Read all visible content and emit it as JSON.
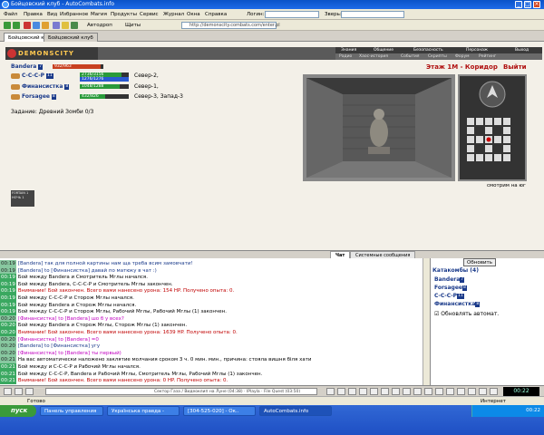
{
  "window": {
    "title": "Бойцовский клуб - AutoCombats.info"
  },
  "menu": {
    "items": [
      "Файл",
      "Правка",
      "Вид",
      "Избранное",
      "Магия",
      "Продукты",
      "Сервис",
      "Журнал",
      "Окна",
      "Справка"
    ],
    "login_label": "Логин:",
    "beast_label": "Зверь:"
  },
  "toolbar": {
    "autodrop": "Автодроп",
    "shields": "Щиты",
    "address": "http://demonscity.combats.com/enter.pl"
  },
  "tabs": [
    "Бойцовский клуб",
    "Бойцовский клуб"
  ],
  "site": {
    "logo": "DEMONSCITY",
    "nav_top": [
      "Знания",
      "Общение",
      "Безопасность",
      "Персонаж",
      "Выход"
    ],
    "nav_sub": [
      "Радио",
      "Хаос-история",
      "События",
      "Скрипты",
      "Форум",
      "Рейтинг"
    ]
  },
  "player": {
    "name": "Bandera",
    "level": "7",
    "hp_text": "932/963"
  },
  "team": [
    {
      "name": "С-С-С-Р",
      "level": "11",
      "hp": "2736/3156",
      "mana": "1276/1276",
      "location": "Север-2,"
    },
    {
      "name": "Финансистка",
      "level": "8",
      "hp": "1048/1288",
      "mana": "",
      "location": "Север-1,"
    },
    {
      "name": "Forsagee",
      "level": "8",
      "hp": "432/826",
      "mana": "",
      "location": "Север-3, Запад-3"
    }
  ],
  "task": "Задание: Древний Зомби 0/3",
  "smallbox": {
    "line1": "FORTAIN 1",
    "line2": "НОЧЬ 1"
  },
  "location": {
    "title": "Этаж 1М - Коридор",
    "exit": "Выйти",
    "facing": "смотрим на юг"
  },
  "chat_tabs": [
    "Чат",
    "Системные сообщения"
  ],
  "chat": [
    {
      "time": "00:19",
      "text": "[Bandera] так для полной картины нам ща треба всим замовчати!",
      "color": "#1a3a8a",
      "green": false
    },
    {
      "time": "00:19",
      "text": "[Bandera] to [Финансистка] давай по матюку в чат :)",
      "color": "#1a3a8a",
      "green": false
    },
    {
      "time": "00:19",
      "text": "Бой между Bandera и Смотритель Мглы начался.",
      "color": "#000",
      "green": true
    },
    {
      "time": "00:19",
      "text": "Бой между Bandera, С-С-С-Р и Смотритель Мглы закончен.",
      "color": "#000",
      "green": true
    },
    {
      "time": "00:19",
      "text": "Внимание! Бой закончен. Всего вами нанесено урона: 154 HP. Получено опыта: 0.",
      "color": "#c00000",
      "green": true
    },
    {
      "time": "00:19",
      "text": "Бой между С-С-С-Р и Сторож Мглы начался.",
      "color": "#000",
      "green": true
    },
    {
      "time": "00:19",
      "text": "Бой между Bandera и Сторож Мглы начался.",
      "color": "#000",
      "green": true
    },
    {
      "time": "00:19",
      "text": "Бой между С-С-С-Р и Сторож Мглы, Рабочий Мглы, Рабочий Мглы (1) закончен.",
      "color": "#000",
      "green": true
    },
    {
      "time": "00:20",
      "text": "[Финансистка] to [Bandera] шо б у всех?",
      "color": "#c000c0",
      "green": false
    },
    {
      "time": "00:20",
      "text": "Бой между Bandera и Сторож Мглы, Сторож Мглы (1) закончен.",
      "color": "#000",
      "green": true
    },
    {
      "time": "00:20",
      "text": "Внимание! Бой закончен. Всего вами нанесено урона: 1639 HP. Получено опыта: 0.",
      "color": "#c00000",
      "green": true
    },
    {
      "time": "00:20",
      "text": "[Финансистка] to [Bandera] =0",
      "color": "#c000c0",
      "green": false
    },
    {
      "time": "00:20",
      "text": "[Bandera] to [Финансистка] угу",
      "color": "#1a3a8a",
      "green": false
    },
    {
      "time": "00:20",
      "text": "[Финансистка] to [Bandera] ты первый)",
      "color": "#c000c0",
      "green": false
    },
    {
      "time": "00:21",
      "text": "На вас автоматически наложено заклятие молчания сроком 3 ч. 0 мин. мин., причина: стояла вишня біля хати",
      "color": "#000",
      "green": false
    },
    {
      "time": "00:21",
      "text": "Бой между и С-С-С-Р и Рабочий Мглы начался.",
      "color": "#000",
      "green": true
    },
    {
      "time": "00:21",
      "text": "Бой между С-С-С-Р, Bandera и Рабочий Мглы, Смотритель Мглы, Рабочий Мглы (1) закончен.",
      "color": "#000",
      "green": true
    },
    {
      "time": "00:21",
      "text": "Внимание! Бой закончен. Всего вами нанесено урона: 0 HP. Получено опыта: 0.",
      "color": "#c00000",
      "green": true
    }
  ],
  "side": {
    "refresh": "Обновить",
    "header": "Катакомбы (4)",
    "members": [
      {
        "name": "Bandera",
        "level": "7"
      },
      {
        "name": "Forsagee",
        "level": "8"
      },
      {
        "name": "С-С-С-Р",
        "level": "11"
      },
      {
        "name": "Финансистка",
        "level": "8"
      }
    ],
    "auto": "Обновлять автомат."
  },
  "clock": "00:22",
  "status": {
    "ready": "Готово",
    "zone": "Интернет"
  },
  "taskbar": {
    "start": "пуск",
    "buttons": [
      "Панель управления",
      "Українська правда -",
      "[304-525-020] - Ок..",
      "AutoCombats.info"
    ],
    "tray": "00:22"
  },
  "ticker": "Сектор Газа / Видеоклип на Луне (04:38)  ·  IPlayla · File Quest (03:50)"
}
